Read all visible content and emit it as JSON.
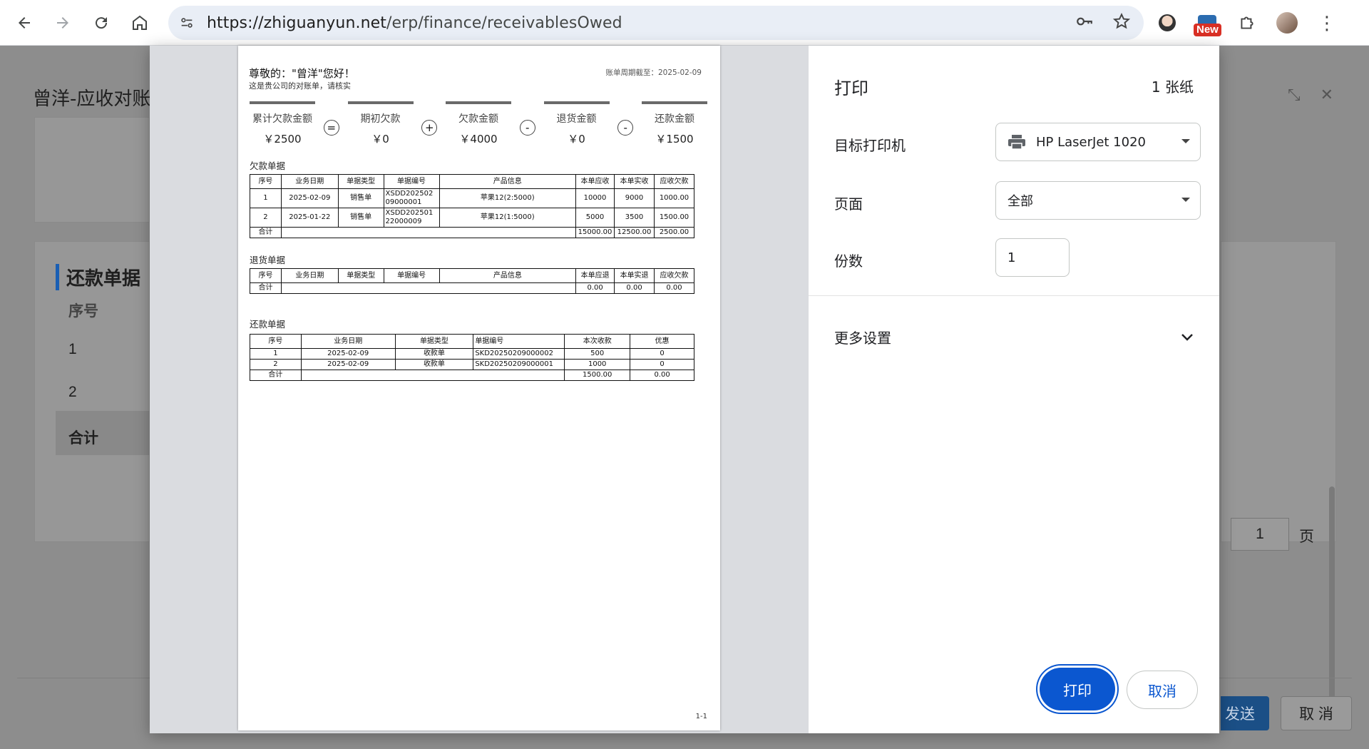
{
  "browser": {
    "url_host": "https://zhiguanyun.net",
    "url_path": "/erp/finance/receivablesOwed",
    "new_badge": "New"
  },
  "background": {
    "title": "曾洋-应收对账单",
    "section_title": "还款单据",
    "col_header": "序号",
    "rows": [
      "1",
      "2",
      "合计"
    ],
    "pager_value": "1",
    "pager_label": "页",
    "send_label": "发送",
    "cancel_label": "取 消"
  },
  "statement": {
    "greeting": "尊敬的：\"曾洋\"您好！",
    "subtitle": "这是贵公司的对账单，请核实",
    "cutoff": "账单周期截至：2025-02-09",
    "summary": [
      {
        "label": "累计欠款金额",
        "value": "￥2500"
      },
      {
        "label": "期初欠款",
        "value": "￥0"
      },
      {
        "label": "欠款金额",
        "value": "￥4000"
      },
      {
        "label": "退货金额",
        "value": "￥0"
      },
      {
        "label": "还款金额",
        "value": "￥1500"
      }
    ],
    "ops": [
      "=",
      "+",
      "-",
      "-"
    ],
    "debt_section": "欠款单据",
    "debt_headers": [
      "序号",
      "业务日期",
      "单据类型",
      "单据编号",
      "产品信息",
      "本单应收",
      "本单实收",
      "应收欠款"
    ],
    "debt_rows": [
      [
        "1",
        "2025-02-09",
        "销售单",
        "XSDD202502 09000001",
        "苹果12(2:5000)",
        "10000",
        "9000",
        "1000.00"
      ],
      [
        "2",
        "2025-01-22",
        "销售单",
        "XSDD202501 22000009",
        "苹果12(1:5000)",
        "5000",
        "3500",
        "1500.00"
      ]
    ],
    "debt_total": [
      "合计",
      "15000.00",
      "12500.00",
      "2500.00"
    ],
    "return_section": "退货单据",
    "return_headers": [
      "序号",
      "业务日期",
      "单据类型",
      "单据编号",
      "产品信息",
      "本单应退",
      "本单实退",
      "应收欠款"
    ],
    "return_total": [
      "合计",
      "0.00",
      "0.00",
      "0.00"
    ],
    "repay_section": "还款单据",
    "repay_headers": [
      "序号",
      "业务日期",
      "单据类型",
      "单据编号",
      "本次收款",
      "优惠"
    ],
    "repay_rows": [
      [
        "1",
        "2025-02-09",
        "收款单",
        "SKD20250209000002",
        "500",
        "0"
      ],
      [
        "2",
        "2025-02-09",
        "收款单",
        "SKD20250209000001",
        "1000",
        "0"
      ]
    ],
    "repay_total": [
      "合计",
      "1500.00",
      "0.00"
    ],
    "page_number": "1-1"
  },
  "print_settings": {
    "title": "打印",
    "sheets": "1 张纸",
    "printer_label": "目标打印机",
    "printer_value": "HP LaserJet 1020",
    "pages_label": "页面",
    "pages_value": "全部",
    "copies_label": "份数",
    "copies_value": "1",
    "more_settings": "更多设置",
    "print_button": "打印",
    "cancel_button": "取消",
    "accent_color": "#0b57d0"
  }
}
